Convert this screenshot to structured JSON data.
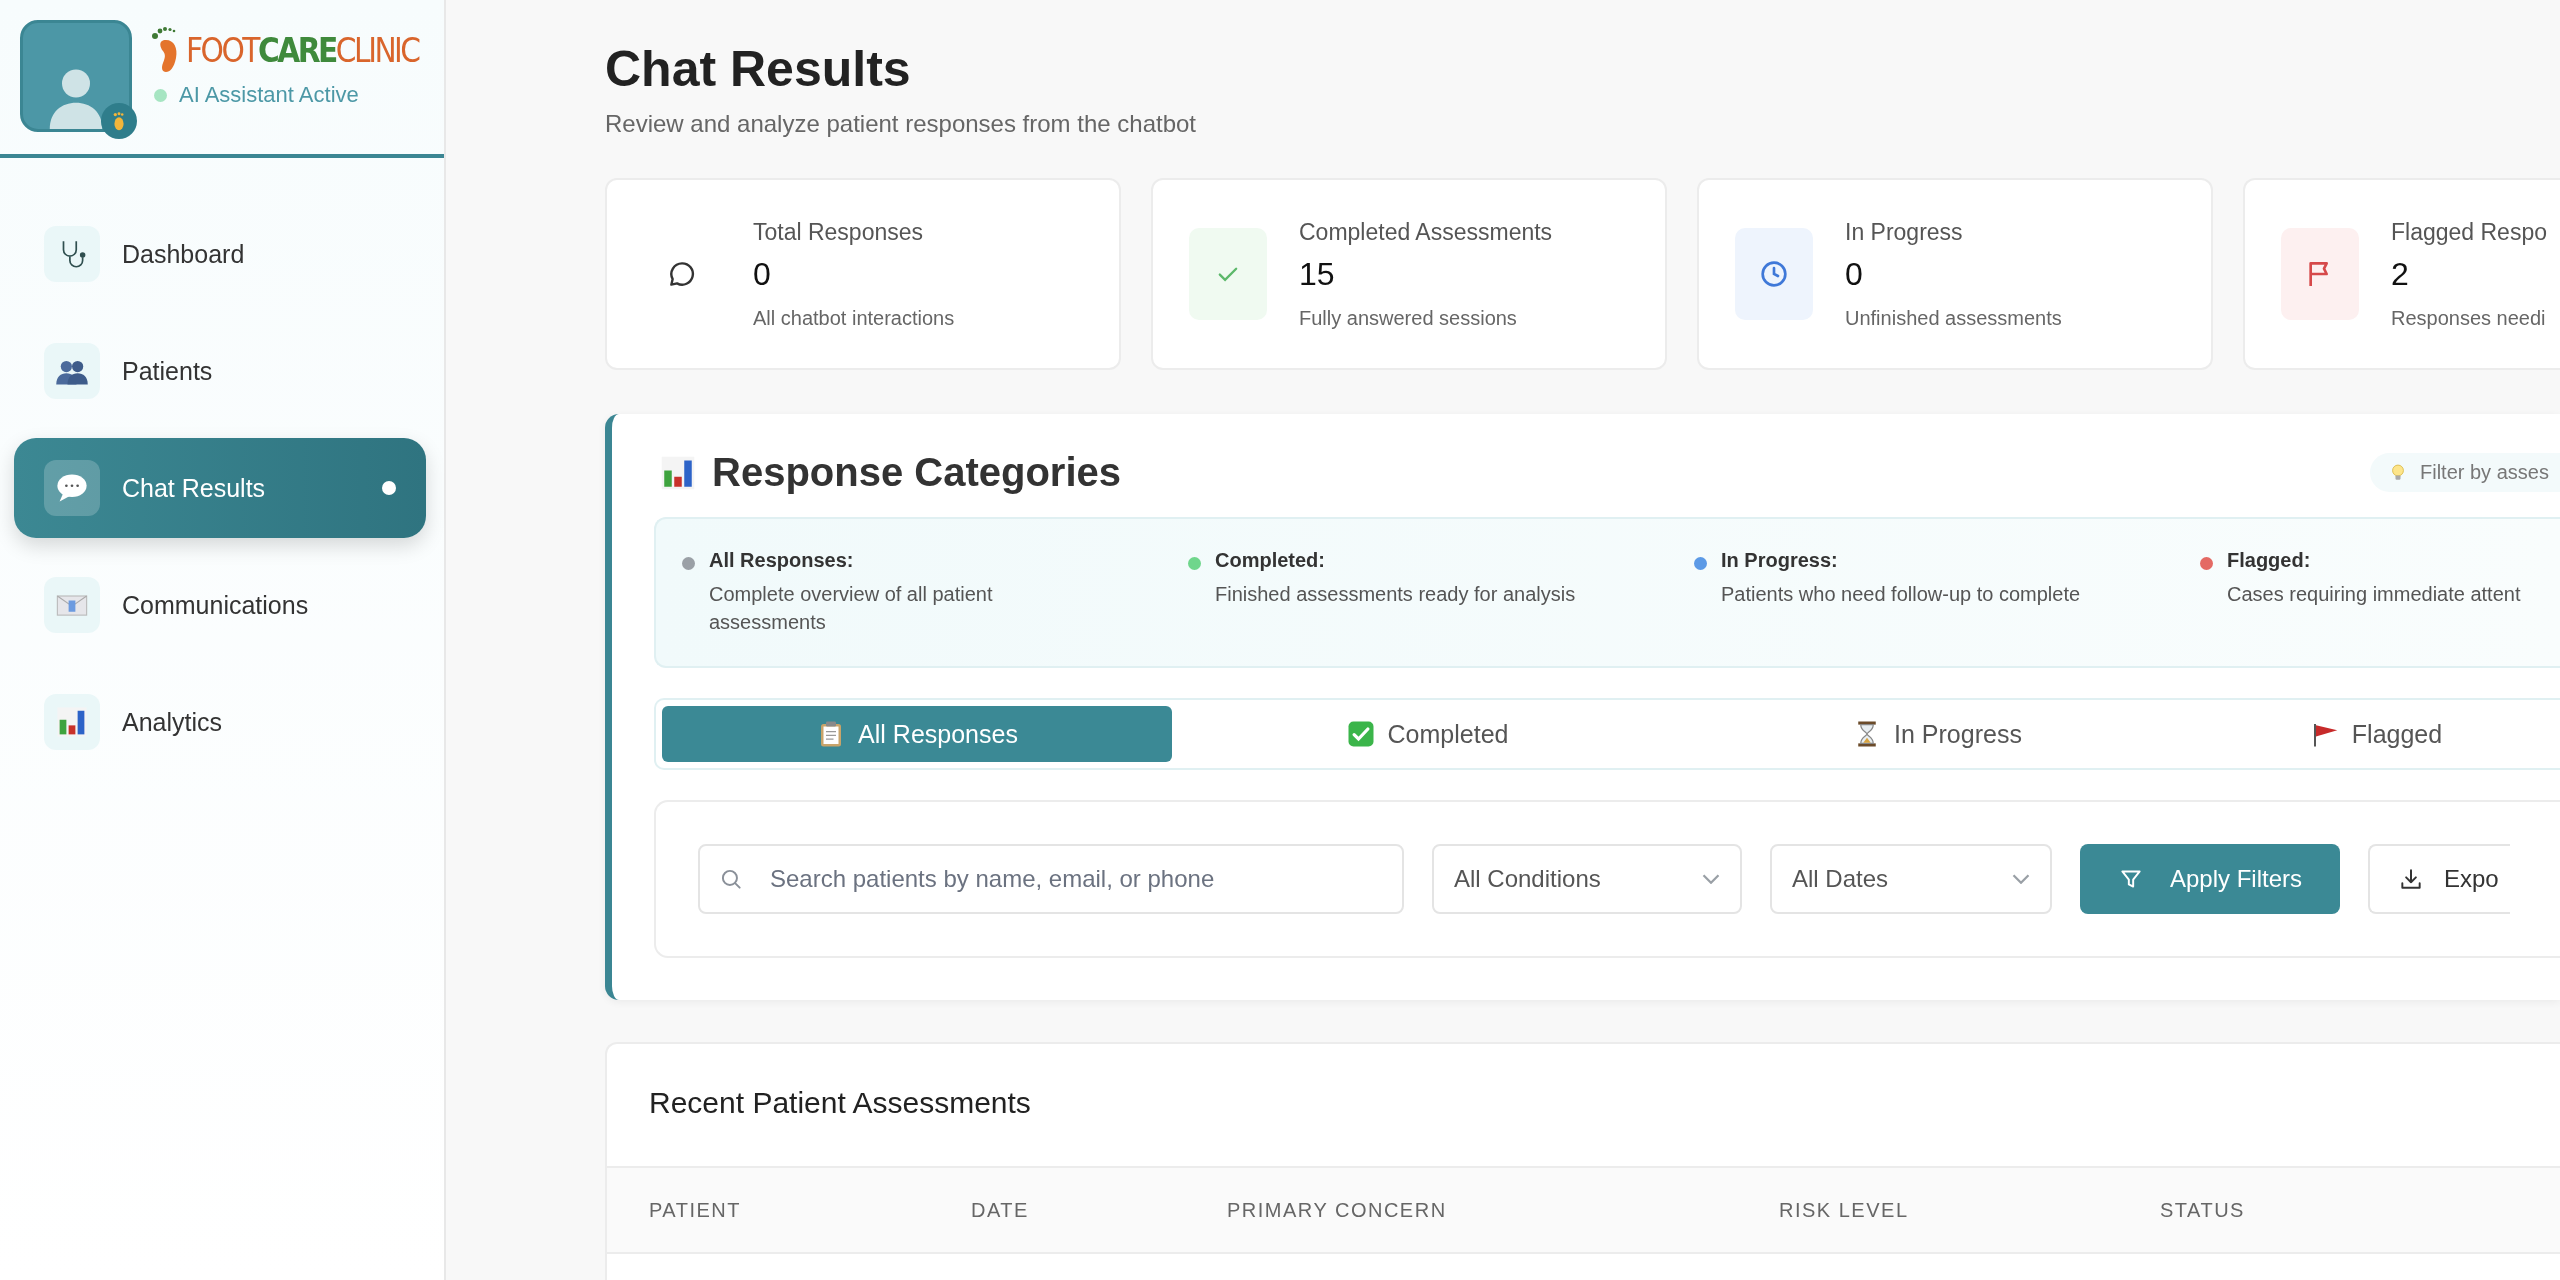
{
  "sidebar": {
    "brand": [
      {
        "text": "FOOT",
        "color": "#d9652c"
      },
      {
        "text": "CARE",
        "color": "#3f8a3c"
      },
      {
        "text": "CLINIC",
        "color": "#d9652c"
      }
    ],
    "status": {
      "label": "AI Assistant Active"
    },
    "nav": [
      {
        "kind": "stethoscope",
        "label": "Dashboard",
        "selected": false
      },
      {
        "kind": "people",
        "label": "Patients",
        "selected": false
      },
      {
        "kind": "speech",
        "label": "Chat Results",
        "selected": true
      },
      {
        "kind": "envelope",
        "label": "Communications",
        "selected": false
      },
      {
        "kind": "chart",
        "label": "Analytics",
        "selected": false
      }
    ]
  },
  "header": {
    "title": "Chat Results",
    "subtitle": "Review and analyze patient responses from the chatbot"
  },
  "stats": [
    {
      "kind": "chat",
      "label": "Total Responses",
      "value": "0",
      "caption": "All chatbot interactions"
    },
    {
      "kind": "check",
      "label": "Completed Assessments",
      "value": "15",
      "caption": "Fully answered sessions"
    },
    {
      "kind": "clock",
      "label": "In Progress",
      "value": "0",
      "caption": "Unfinished assessments"
    },
    {
      "kind": "flag",
      "label": "Flagged Respo",
      "value": "2",
      "caption": "Responses needi"
    }
  ],
  "categories": {
    "title": "Response Categories",
    "hint": "Filter by asses",
    "legend": [
      {
        "label": "All Responses:",
        "description": "Complete overview of all patient assessments",
        "color": "#9aa0a6"
      },
      {
        "label": "Completed:",
        "description": "Finished assessments ready for analysis",
        "color": "#6fd68c"
      },
      {
        "label": "In Progress:",
        "description": "Patients who need follow-up to complete",
        "color": "#5c9ae6"
      },
      {
        "label": "Flagged:",
        "description": "Cases requiring immediate attent",
        "color": "#e46a64"
      }
    ],
    "tabs": [
      {
        "kind": "clipboard",
        "label": "All Responses",
        "selected": true
      },
      {
        "kind": "checkbox",
        "label": "Completed",
        "selected": false
      },
      {
        "kind": "hourglass",
        "label": "In Progress",
        "selected": false
      },
      {
        "kind": "pennant",
        "label": "Flagged",
        "selected": false
      }
    ]
  },
  "filters": {
    "search": {
      "placeholder": "Search patients by name, email, or phone"
    },
    "selects": [
      {
        "value": "All Conditions"
      },
      {
        "value": "All Dates"
      }
    ],
    "apply": "Apply Filters",
    "export": "Expo"
  },
  "table": {
    "title": "Recent Patient Assessments",
    "columns": [
      "PATIENT",
      "DATE",
      "PRIMARY CONCERN",
      "RISK LEVEL",
      "STATUS"
    ]
  }
}
